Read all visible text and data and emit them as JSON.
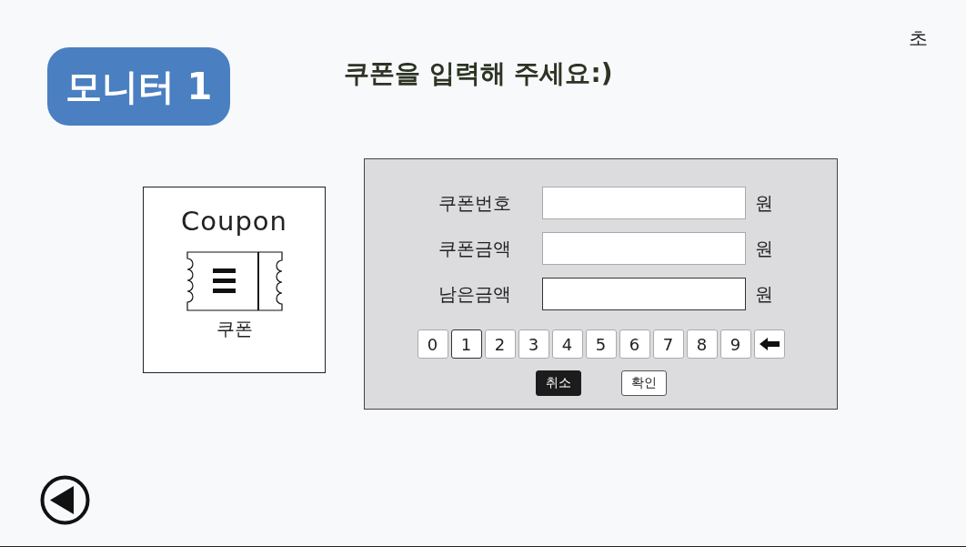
{
  "header": {
    "badge": "모니터 1",
    "title": "쿠폰을 입력해 주세요:)",
    "timer_unit": "초"
  },
  "coupon_card": {
    "title": "Coupon",
    "caption": "쿠폰"
  },
  "form": {
    "fields": [
      {
        "label": "쿠폰번호",
        "unit": "원",
        "active": false
      },
      {
        "label": "쿠폰금액",
        "unit": "원",
        "active": false
      },
      {
        "label": "남은금액",
        "unit": "원",
        "active": true
      }
    ],
    "keypad": [
      {
        "kind": "digit",
        "label": "0",
        "selected": false
      },
      {
        "kind": "digit",
        "label": "1",
        "selected": true
      },
      {
        "kind": "digit",
        "label": "2",
        "selected": false
      },
      {
        "kind": "digit",
        "label": "3",
        "selected": false
      },
      {
        "kind": "digit",
        "label": "4",
        "selected": false
      },
      {
        "kind": "digit",
        "label": "5",
        "selected": false
      },
      {
        "kind": "digit",
        "label": "6",
        "selected": false
      },
      {
        "kind": "digit",
        "label": "7",
        "selected": false
      },
      {
        "kind": "digit",
        "label": "8",
        "selected": false
      },
      {
        "kind": "digit",
        "label": "9",
        "selected": false
      },
      {
        "kind": "backspace",
        "selected": false
      }
    ],
    "buttons": [
      {
        "kind": "primary",
        "label": "취소"
      },
      {
        "kind": "secondary",
        "label": "확인"
      }
    ]
  }
}
